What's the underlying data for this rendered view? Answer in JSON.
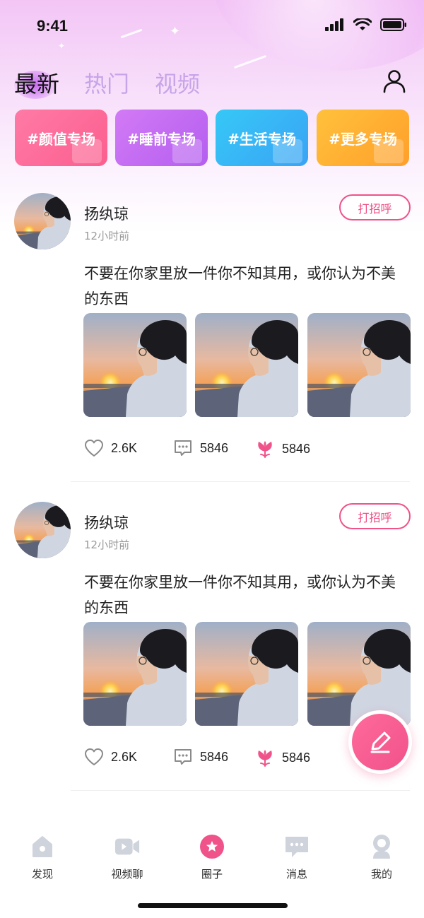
{
  "status_bar": {
    "time": "9:41"
  },
  "header": {
    "tabs": [
      {
        "label": "最新",
        "active": true
      },
      {
        "label": "热门",
        "active": false
      },
      {
        "label": "视频",
        "active": false
      }
    ],
    "profile_icon": "user-icon"
  },
  "categories": [
    {
      "label": "#颜值专场",
      "color_from": "#ff7aa6",
      "color_to": "#fb5f8f"
    },
    {
      "label": "#睡前专场",
      "color_from": "#d27af5",
      "color_to": "#b45ef0"
    },
    {
      "label": "#生活专场",
      "color_from": "#36c8f6",
      "color_to": "#3aa3f5"
    },
    {
      "label": "#更多专场",
      "color_from": "#ffc13c",
      "color_to": "#ff9f2a"
    }
  ],
  "posts": [
    {
      "username": "扬纨琼",
      "time": "12小时前",
      "greet_label": "打招呼",
      "text": "不要在你家里放一件你不知其用，或你认为不美的东西",
      "likes": "2.6K",
      "comments": "5846",
      "flowers": "5846"
    },
    {
      "username": "扬纨琼",
      "time": "12小时前",
      "greet_label": "打招呼",
      "text": "不要在你家里放一件你不知其用，或你认为不美的东西",
      "likes": "2.6K",
      "comments": "5846",
      "flowers": "5846"
    }
  ],
  "fab": {
    "icon": "edit-icon"
  },
  "bottom_nav": [
    {
      "label": "发现",
      "icon": "home-icon",
      "active": false
    },
    {
      "label": "视频聊",
      "icon": "video-icon",
      "active": false
    },
    {
      "label": "圈子",
      "icon": "star-icon",
      "active": true
    },
    {
      "label": "消息",
      "icon": "message-icon",
      "active": false
    },
    {
      "label": "我的",
      "icon": "profile-icon",
      "active": false
    }
  ],
  "colors": {
    "accent": "#f0528a",
    "tab_inactive": "#c7a4e8",
    "nav_inactive": "#cfd3dc"
  }
}
